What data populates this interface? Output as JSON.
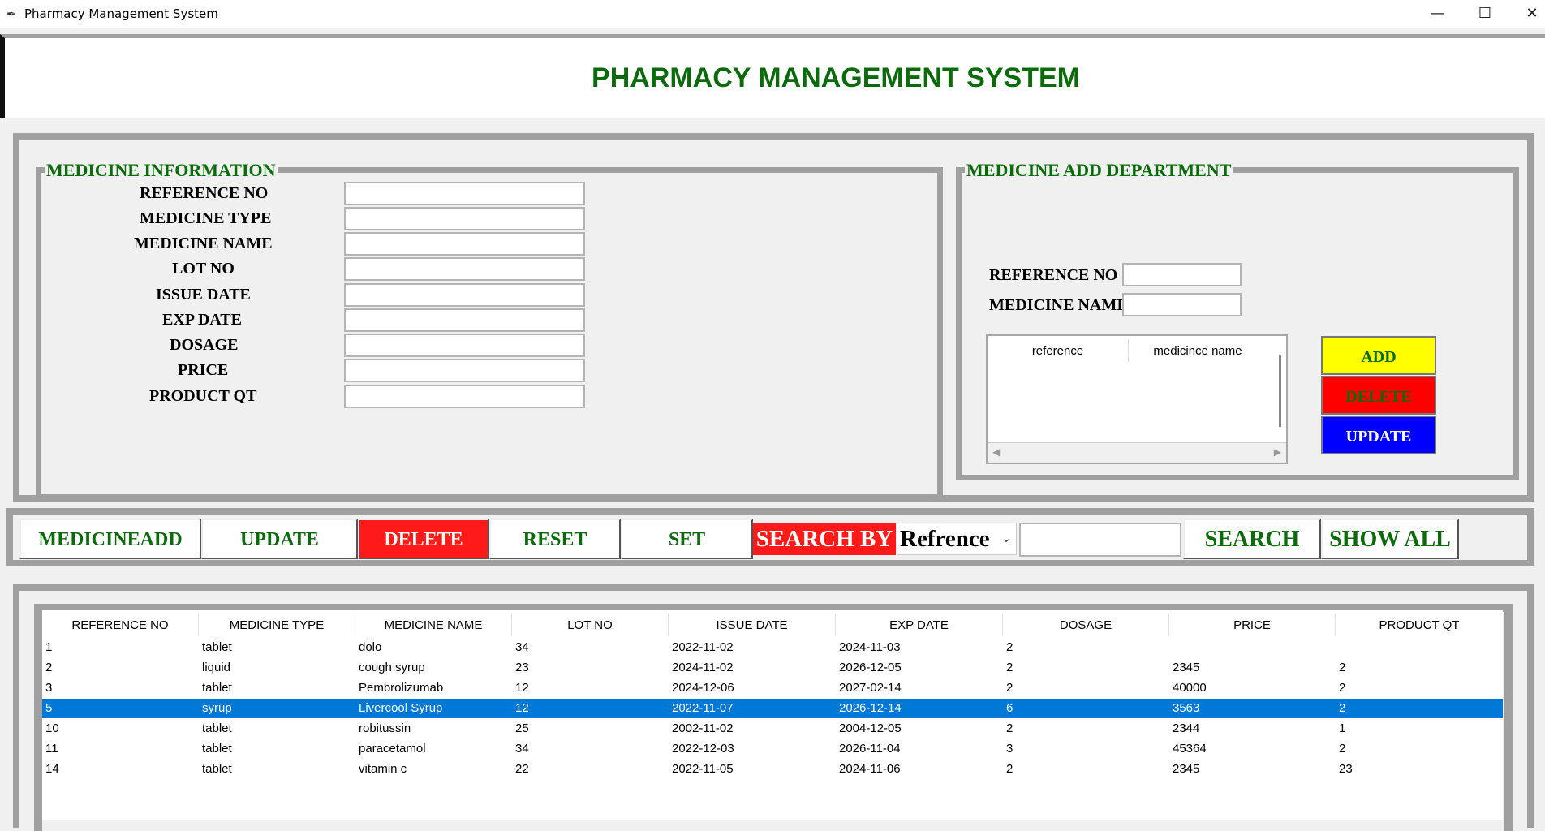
{
  "window": {
    "title": "Pharmacy Management System",
    "minimize": "—",
    "maximize": "☐",
    "close": "✕"
  },
  "header": {
    "title": "PHARMACY MANAGEMENT SYSTEM"
  },
  "med_info": {
    "legend": "MEDICINE INFORMATION",
    "labels": [
      "REFERENCE NO",
      "MEDICINE TYPE",
      "MEDICINE NAME",
      "LOT NO",
      "ISSUE DATE",
      "EXP DATE",
      "DOSAGE",
      "PRICE",
      "PRODUCT QT"
    ]
  },
  "med_add": {
    "legend": "MEDICINE ADD DEPARTMENT",
    "ref_label": "REFERENCE NO",
    "name_label": "MEDICINE NAMI",
    "table_headers": [
      "reference",
      "medicince name"
    ],
    "add": "ADD",
    "delete": "DELETE",
    "update": "UPDATE"
  },
  "actions": {
    "medicineadd": "MEDICINEADD",
    "update": "UPDATE",
    "delete": "DELETE",
    "reset": "RESET",
    "set": "SET",
    "search_by": "SEARCH BY",
    "search_by_value": "Refrence",
    "search": "SEARCH",
    "show_all": "SHOW ALL"
  },
  "colors": {
    "green": "#0b6b0b",
    "red": "#ff1a1a",
    "yellow": "#ffff00",
    "blue": "#0000ff",
    "selection": "#0078d7"
  },
  "grid": {
    "columns": [
      "REFERENCE NO",
      "MEDICINE TYPE",
      "MEDICINE NAME",
      "LOT NO",
      "ISSUE DATE",
      "EXP DATE",
      "DOSAGE",
      "PRICE",
      "PRODUCT QT"
    ],
    "rows": [
      [
        "1",
        "tablet",
        "dolo",
        "34",
        "2022-11-02",
        "2024-11-03",
        "2",
        "",
        ""
      ],
      [
        "2",
        "liquid",
        "cough syrup",
        "23",
        "2024-11-02",
        "2026-12-05",
        "2",
        "2345",
        "2"
      ],
      [
        "3",
        "tablet",
        "Pembrolizumab",
        "12",
        "2024-12-06",
        "2027-02-14",
        "2",
        "40000",
        "2"
      ],
      [
        "5",
        "syrup",
        "Livercool Syrup",
        "12",
        "2022-11-07",
        "2026-12-14",
        "6",
        "3563",
        "2"
      ],
      [
        "10",
        "tablet",
        "robitussin",
        "25",
        "2002-11-02",
        "2004-12-05",
        "2",
        "2344",
        "1"
      ],
      [
        "11",
        "tablet",
        "paracetamol",
        "34",
        "2022-12-03",
        "2026-11-04",
        "3",
        "45364",
        "2"
      ],
      [
        "14",
        "tablet",
        "vitamin c",
        "22",
        "2022-11-05",
        "2024-11-06",
        "2",
        "2345",
        "23"
      ]
    ]
  }
}
